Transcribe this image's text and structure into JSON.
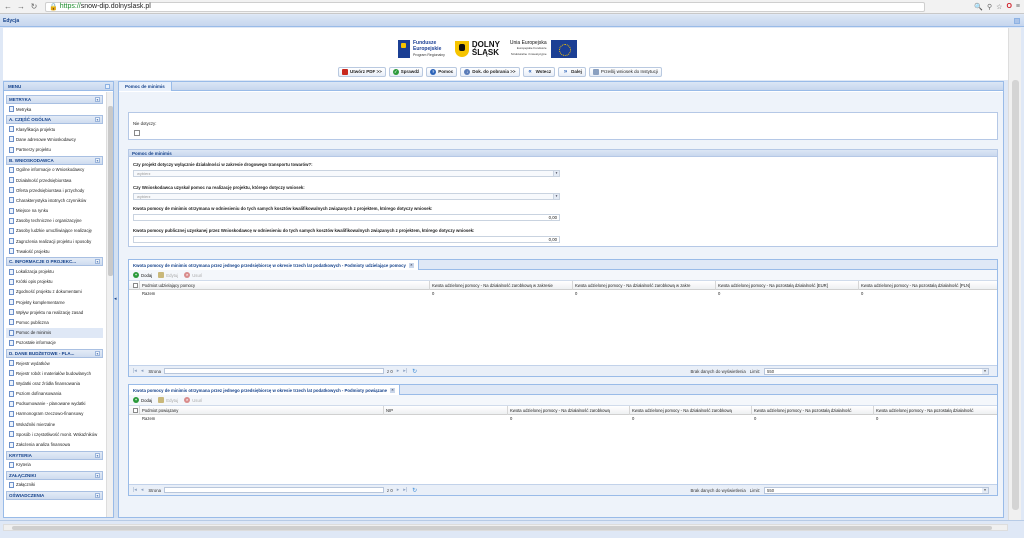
{
  "browser": {
    "url_scheme": "https://",
    "url_host": "snow-dip.dolnyslask.pl"
  },
  "app": {
    "title": "Edycja"
  },
  "logos": {
    "fe_line1": "Fundusze",
    "fe_line2": "Europejskie",
    "fe_line3": "Program Regionalny",
    "ds_line1": "DOLNY",
    "ds_line2": "ŚLĄSK",
    "ue_line1": "Unia Europejska",
    "ue_line2": "Europejskie Fundusze",
    "ue_line3": "Strukturalne i Inwestycyjne"
  },
  "toolbar": {
    "pdf": "Utwórz PDF >>",
    "check": "Sprawdź",
    "help": "Pomoc",
    "download": "Dok. do pobrania >>",
    "back": "Wstecz",
    "next": "Dalej",
    "send": "Prześlij wniosek do Instytucji"
  },
  "menu": {
    "title": "MENU",
    "sections": [
      {
        "label": "METRYKA",
        "items": [
          "Metryka"
        ]
      },
      {
        "label": "A. CZĘŚĆ OGÓLNA",
        "items": [
          "Klasyfikacja projektu",
          "Dane adresowe Wnioskodawcy",
          "Partnerzy projektu"
        ]
      },
      {
        "label": "B. WNIOSKODAWCA",
        "items": [
          "Ogólne informacje o Wnioskodawcy",
          "Działalność przedsiębiorstwa",
          "Oferta przedsiębiorstwa i przychody",
          "Charakterystyka istotnych czynników",
          "Miejsce na rynku",
          "Zasoby techniczne i organizacyjne",
          "Zasoby ludzkie umożliwiające realizację",
          "Zagrożenia realizacji projektu i sposoby",
          "Trwałość projektu"
        ]
      },
      {
        "label": "C. INFORMACJE O PROJEKC...",
        "items": [
          "Lokalizacja projektu",
          "Krótki opis projektu",
          "Zgodność projektu z dokumentami",
          "Projekty komplementarne",
          "Wpływ projektu na realizację zasad",
          "Pomoc publiczna",
          "Pomoc de minimis",
          "Pozostałe informacje"
        ]
      },
      {
        "label": "D. DANE BUDŻETOWE - PLA...",
        "items": [
          "Rejestr wydatków",
          "Rejestr robót i materiałów budowlanych",
          "Wydatki oraz źródła finansowania",
          "Poziom dofinansowania",
          "Podsumowanie - planowane wydatki",
          "Harmonogram rzeczowo-finansowy",
          "Wskaźniki mierzalne",
          "Sposób i częstotliwość monit. Wskaźników",
          "Założenia analiza finansowa"
        ]
      },
      {
        "label": "KRYTERIA",
        "items": [
          "Kryteria"
        ]
      },
      {
        "label": "ZAŁĄCZNIKI",
        "items": [
          "Załączniki"
        ]
      },
      {
        "label": "OŚWIADCZENIA",
        "items": []
      }
    ]
  },
  "main": {
    "tab": "Pomoc de minimis",
    "not_applicable_label": "Nie dotyczy:",
    "fieldset_title": "Pomoc de minimis",
    "q1": "Czy projekt dotyczy wyłącznie działalności w zakresie drogowego transportu towarów?:",
    "q1_placeholder": "wybierz",
    "q2": "Czy Wnioskodawca uzyskał pomoc na realizację projektu, którego dotyczy wniosek:",
    "q2_placeholder": "wybierz",
    "q3": "Kwota pomocy de minimis otrzymana w odniesieniu do tych samych kosztów kwalifikowalnych związanych z projektem, którego dotyczy wniosek:",
    "q3_value": "0,00",
    "q4": "Kwota pomocy publicznej uzyskanej przez Wnioskodawcę w odniesieniu do tych samych kosztów kwalifikowalnych związanych z projektem, którego dotyczy wniosek:",
    "q4_value": "0,00"
  },
  "grids": {
    "add": "Dodaj",
    "edit": "Edytuj",
    "delete": "Usuń",
    "page": "Strona",
    "of": "z 0",
    "no_data": "Brak danych do wyświetlenia",
    "limit": "Limit:",
    "limit_value": "550",
    "grid1": {
      "tab": "Kwota pomocy de minimis otrzymana przez jednego przedsiębiorcę w okresie trzech lat podatkowych - Podmioty udzielające pomocy",
      "columns": [
        "Podmiot udzielający pomocy",
        "Kwota udzielonej pomocy - Na działalność zarobkową w zakresie",
        "Kwota udzielonej pomocy - Na działalność zarobkową w zakre",
        "Kwota udzielonej pomocy - Na pozostałą działalność [EUR]",
        "Kwota udzielonej pomocy - Na pozostałą działalność [PLN]"
      ],
      "row": [
        "Razem",
        "0",
        "0",
        "0",
        "0"
      ]
    },
    "grid2": {
      "tab": "Kwota pomocy de minimis otrzymana przez jednego przedsiębiorcę w okresie trzech lat podatkowych - Podmioty powiązane",
      "columns": [
        "Podmiot powiązany",
        "NIP",
        "Kwota udzielonej pomocy - Na działalność zarobkową",
        "Kwota udzielonej pomocy - Na działalność zarobkową",
        "Kwota udzielonej pomocy - Na pozostałą działalność",
        "Kwota udzielonej pomocy - Na pozostałą działalność"
      ],
      "row": [
        "Razem",
        "",
        "0",
        "0",
        "0",
        "0"
      ]
    }
  }
}
